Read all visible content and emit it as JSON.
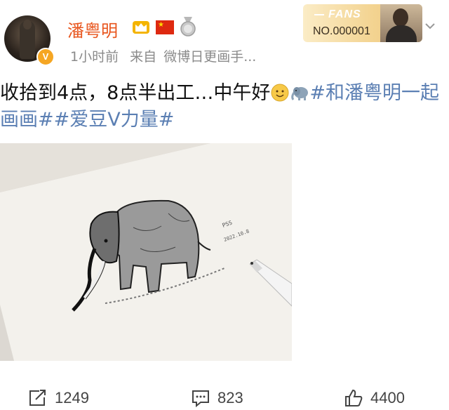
{
  "user": {
    "name": "潘粤明",
    "verified_badge": "V",
    "time": "1小时前",
    "source_prefix": "来自",
    "source": "微博日更画手..."
  },
  "fans_badge": {
    "label": "FANS",
    "number": "NO.000001"
  },
  "post": {
    "text": "收拾到4点，8点半出工…中午好",
    "tags": "#和潘粤明一起画画##爱豆V力量#",
    "emojis": [
      "smile-emoji",
      "elephant-emoji"
    ]
  },
  "image": {
    "signature": "PSS",
    "date": "2022.10.8"
  },
  "actions": {
    "repost_count": "1249",
    "comment_count": "823",
    "like_count": "4400"
  },
  "colors": {
    "name": "#e8551d",
    "tag": "#5b7fb3",
    "meta": "#8a8a8a"
  }
}
